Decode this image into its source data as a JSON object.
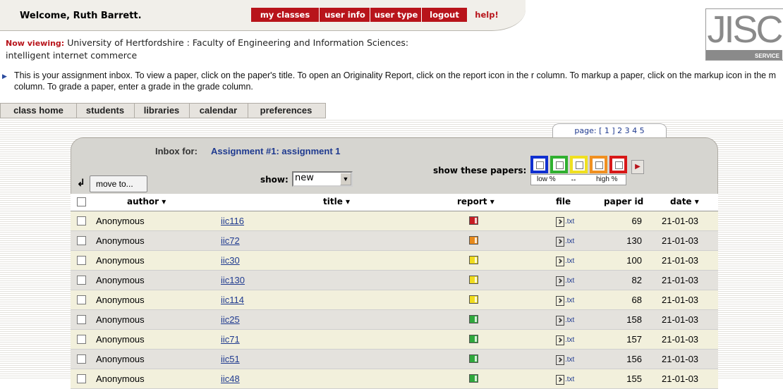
{
  "header": {
    "welcome": "Welcome, Ruth Barrett.",
    "nav": [
      "my classes",
      "user info",
      "user type",
      "logout"
    ],
    "help": "help!",
    "now_viewing_label": "Now viewing:",
    "now_viewing_line1": "University of Hertfordshire : Faculty of Engineering and Information Sciences:",
    "now_viewing_line2": "intelligent internet commerce"
  },
  "logo": {
    "text": "JISC",
    "sub": "SERVICE"
  },
  "instructions": "This is your assignment inbox. To view a paper, click on the paper's title. To open an Originality Report, click on the report icon in the r column. To markup a paper, click on the markup icon in the m column. To grade a paper, enter a grade in the grade column.",
  "tabs": [
    "class home",
    "students",
    "libraries",
    "calendar",
    "preferences"
  ],
  "pagination": {
    "label": "page:",
    "current": "[ 1 ]",
    "pages": "2 3 4 5"
  },
  "inbox": {
    "label": "Inbox for:",
    "assignment": "Assignment #1: assignment 1",
    "show_label": "show:",
    "show_value": "new",
    "show_papers_label": "show these papers:",
    "legend_low": "low %",
    "legend_arrow": "↔",
    "legend_high": "high %",
    "palette_colors": [
      "#1030d0",
      "#30b030",
      "#f0e020",
      "#f09020",
      "#d81818"
    ],
    "move_to": "move to..."
  },
  "table": {
    "headers": {
      "author": "author ▾",
      "title": "title ▾",
      "report": "report ▾",
      "file": "file",
      "paper_id": "paper id",
      "date": "date ▾"
    },
    "rows": [
      {
        "author": "Anonymous",
        "title": "iic116",
        "report_color": "#c81e24",
        "file": ".txt",
        "paper_id": "69",
        "date": "21-01-03"
      },
      {
        "author": "Anonymous",
        "title": "iic72",
        "report_color": "#e88a1a",
        "file": ".txt",
        "paper_id": "130",
        "date": "21-01-03"
      },
      {
        "author": "Anonymous",
        "title": "iic30",
        "report_color": "#f0dc1e",
        "file": ".txt",
        "paper_id": "100",
        "date": "21-01-03"
      },
      {
        "author": "Anonymous",
        "title": "iic130",
        "report_color": "#f0dc1e",
        "file": ".txt",
        "paper_id": "82",
        "date": "21-01-03"
      },
      {
        "author": "Anonymous",
        "title": "iic114",
        "report_color": "#f0dc1e",
        "file": ".txt",
        "paper_id": "68",
        "date": "21-01-03"
      },
      {
        "author": "Anonymous",
        "title": "iic25",
        "report_color": "#2fa83c",
        "file": ".txt",
        "paper_id": "158",
        "date": "21-01-03"
      },
      {
        "author": "Anonymous",
        "title": "iic71",
        "report_color": "#2fa83c",
        "file": ".txt",
        "paper_id": "157",
        "date": "21-01-03"
      },
      {
        "author": "Anonymous",
        "title": "iic51",
        "report_color": "#2fa83c",
        "file": ".txt",
        "paper_id": "156",
        "date": "21-01-03"
      },
      {
        "author": "Anonymous",
        "title": "iic48",
        "report_color": "#2fa83c",
        "file": ".txt",
        "paper_id": "155",
        "date": "21-01-03"
      }
    ],
    "row_colors": [
      "#f2f0dc",
      "#e4e2dd"
    ]
  }
}
